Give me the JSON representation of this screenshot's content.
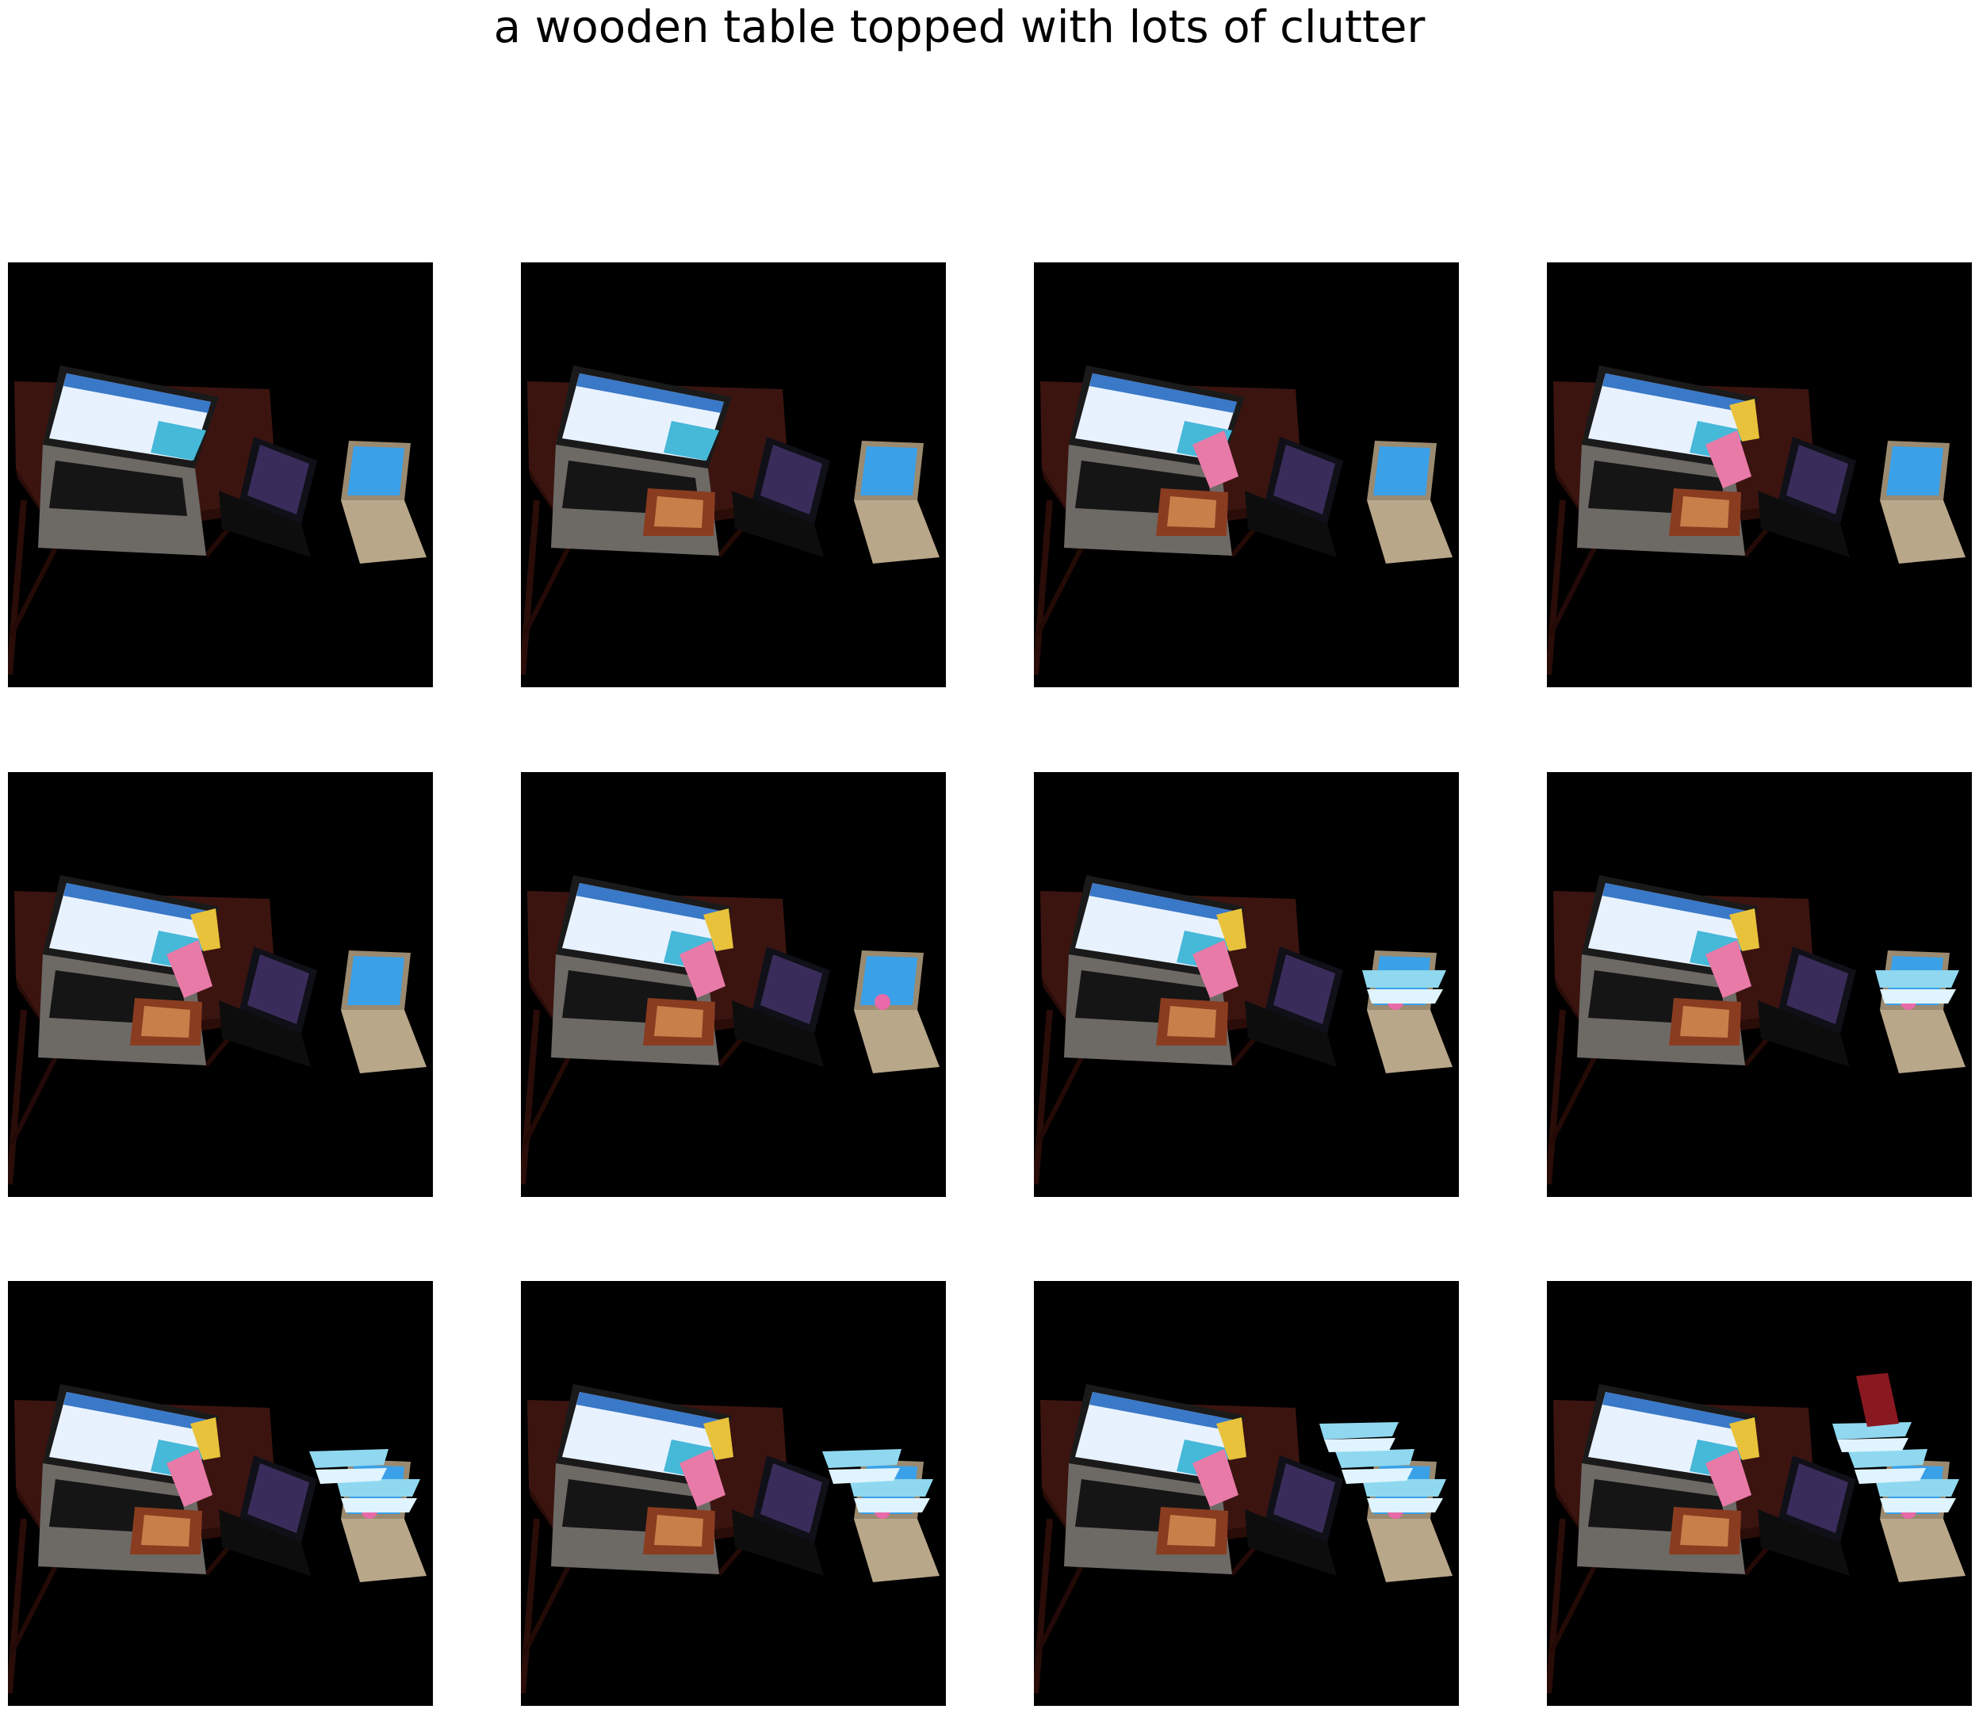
{
  "title": "a wooden table topped with lots of clutter",
  "grid": {
    "rows": 3,
    "cols": 4
  },
  "frames": [
    {
      "index": 1,
      "extras": []
    },
    {
      "index": 2,
      "extras": [
        "photo"
      ]
    },
    {
      "index": 3,
      "extras": [
        "photo",
        "card"
      ]
    },
    {
      "index": 4,
      "extras": [
        "photo",
        "card",
        "tag"
      ]
    },
    {
      "index": 5,
      "extras": [
        "photo",
        "card",
        "tag"
      ]
    },
    {
      "index": 6,
      "extras": [
        "photo",
        "card",
        "tag",
        "flower"
      ]
    },
    {
      "index": 7,
      "extras": [
        "photo",
        "card",
        "tag",
        "flower",
        "stack1"
      ]
    },
    {
      "index": 8,
      "extras": [
        "photo",
        "card",
        "tag",
        "flower",
        "stack1"
      ]
    },
    {
      "index": 9,
      "extras": [
        "photo",
        "card",
        "tag",
        "flower",
        "stack1",
        "stack2"
      ]
    },
    {
      "index": 10,
      "extras": [
        "photo",
        "card",
        "tag",
        "flower",
        "stack1",
        "stack2"
      ]
    },
    {
      "index": 11,
      "extras": [
        "photo",
        "card",
        "tag",
        "flower",
        "stack1",
        "stack2",
        "stack3"
      ]
    },
    {
      "index": 12,
      "extras": [
        "photo",
        "card",
        "tag",
        "flower",
        "stack1",
        "stack2",
        "stack3",
        "redbox"
      ]
    }
  ]
}
